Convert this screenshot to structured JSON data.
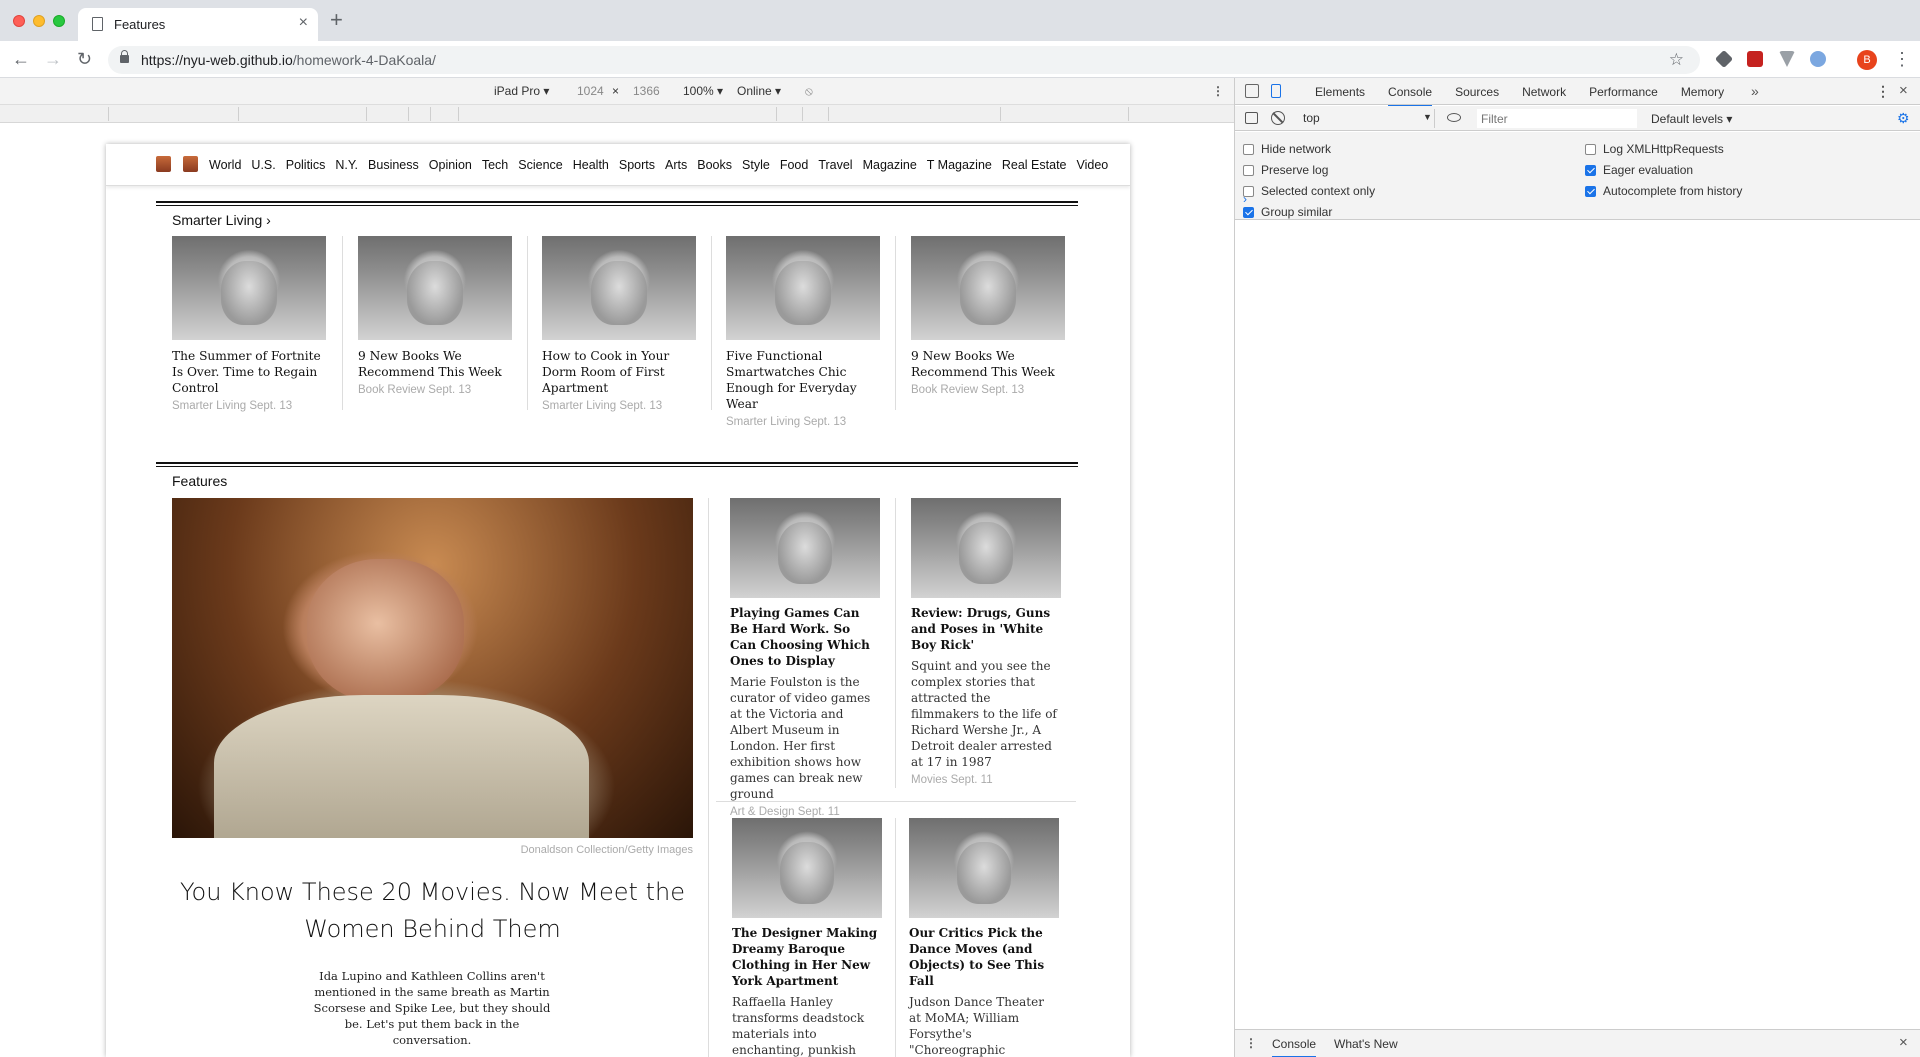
{
  "browser": {
    "tab_title": "Features",
    "url_host": "https://nyu-web.github.io",
    "url_path": "/homework-4-DaKoala/",
    "avatar_letter": "B"
  },
  "device_toolbar": {
    "device": "iPad Pro ▾",
    "width": "1024",
    "times": "×",
    "height": "1366",
    "zoom": "100% ▾",
    "network": "Online ▾"
  },
  "site": {
    "nav": [
      "World",
      "U.S.",
      "Politics",
      "N.Y.",
      "Business",
      "Opinion",
      "Tech",
      "Science",
      "Health",
      "Sports",
      "Arts",
      "Books",
      "Style",
      "Food",
      "Travel",
      "Magazine",
      "T Magazine",
      "Real Estate",
      "Video"
    ],
    "smarter_living": {
      "title": "Smarter Living ›",
      "cards": [
        {
          "headline": "The Summer of Fortnite Is Over. Time to Regain Control",
          "meta": "Smarter Living Sept. 13"
        },
        {
          "headline": "9 New Books We Recommend This Week",
          "meta": "Book Review Sept. 13"
        },
        {
          "headline": "How to Cook in Your Dorm Room of First Apartment",
          "meta": "Smarter Living Sept. 13"
        },
        {
          "headline": "Five Functional Smartwatches Chic Enough for Everyday Wear",
          "meta": "Smarter Living Sept. 13"
        },
        {
          "headline": "9 New Books We Recommend This Week",
          "meta": "Book Review Sept. 13"
        }
      ]
    },
    "features": {
      "title": "Features",
      "credit": "Donaldson Collection/Getty Images",
      "lead_title": "You Know These 20 Movies. Now Meet the Women Behind Them",
      "lead_summary": "Ida Lupino and Kathleen Collins aren't mentioned in the same breath as Martin Scorsese and Spike Lee, but they should be. Let's put them back in the conversation.",
      "cards": [
        {
          "headline": "Playing Games Can Be Hard Work. So Can Choosing Which Ones to Display",
          "summary": "Marie Foulston is the curator of video games at the Victoria and Albert Museum in London. Her first exhibition shows how games can break new ground",
          "meta": "Art & Design Sept. 11"
        },
        {
          "headline": "Review: Drugs, Guns and Poses in 'White Boy Rick'",
          "summary": "Squint and you see the complex stories that attracted the filmmakers to the life of Richard Wershe Jr., A Detroit dealer arrested at 17 in 1987",
          "meta": "Movies Sept. 11"
        },
        {
          "headline": "The Designer Making Dreamy Baroque Clothing in Her New York Apartment",
          "summary": "Raffaella Hanley transforms deadstock materials into enchanting, punkish",
          "meta": ""
        },
        {
          "headline": "Our Critics Pick the Dance Moves (and Objects) to See This Fall",
          "summary": "Judson Dance Theater at MoMA; William Forsythe's \"Choreographic Objects\"; Balanchine at City Center; and a Claudia Rankine-",
          "meta": ""
        }
      ]
    }
  },
  "devtools": {
    "tabs": [
      "Elements",
      "Console",
      "Sources",
      "Network",
      "Performance",
      "Memory"
    ],
    "active_tab": "Console",
    "more": "»",
    "context": "top",
    "filter_placeholder": "Filter",
    "levels": "Default levels ▾",
    "settings_left": [
      {
        "label": "Hide network",
        "checked": false
      },
      {
        "label": "Preserve log",
        "checked": false
      },
      {
        "label": "Selected context only",
        "checked": false
      },
      {
        "label": "Group similar",
        "checked": true
      }
    ],
    "settings_right": [
      {
        "label": "Log XMLHttpRequests",
        "checked": false
      },
      {
        "label": "Eager evaluation",
        "checked": true
      },
      {
        "label": "Autocomplete from history",
        "checked": true
      }
    ],
    "prompt": "›",
    "drawer_tabs": [
      "Console",
      "What's New"
    ]
  },
  "icons": [
    "document-icon",
    "close-icon",
    "plus-icon",
    "back-arrow-icon",
    "forward-arrow-icon",
    "reload-icon",
    "lock-icon",
    "star-icon",
    "rotate-icon",
    "inspect-icon",
    "device-icon",
    "gear-icon",
    "eye-icon",
    "clear-console-icon"
  ]
}
